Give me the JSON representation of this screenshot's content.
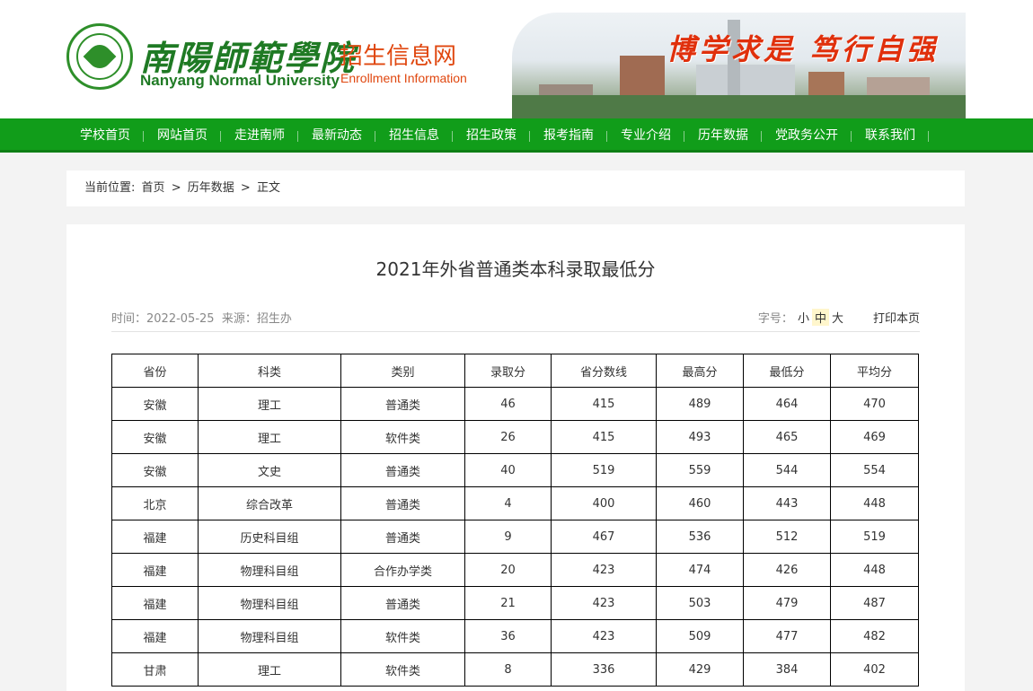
{
  "header": {
    "logo_text_cn": "南陽師範學院",
    "logo_text_en": "Nanyang Normal University",
    "site_title_cn": "招生信息网",
    "site_title_en": "Enrollment Information",
    "motto": "博学求是 笃行自强"
  },
  "nav": {
    "items": [
      {
        "label": "学校首页"
      },
      {
        "label": "网站首页"
      },
      {
        "label": "走进南师"
      },
      {
        "label": "最新动态"
      },
      {
        "label": "招生信息"
      },
      {
        "label": "招生政策"
      },
      {
        "label": "报考指南"
      },
      {
        "label": "专业介绍"
      },
      {
        "label": "历年数据"
      },
      {
        "label": "党政务公开"
      },
      {
        "label": "联系我们"
      }
    ]
  },
  "breadcrumb": {
    "prefix": "当前位置:",
    "home": "首页",
    "sep": ">",
    "section": "历年数据",
    "current": "正文"
  },
  "article": {
    "title": "2021年外省普通类本科录取最低分",
    "time_label": "时间：",
    "time": "2022-05-25",
    "source_label": "来源：",
    "source": "招生办",
    "font_size_label": "字号：",
    "font_small": "小",
    "font_medium": "中",
    "font_large": "大",
    "print_label": "打印本页"
  },
  "table": {
    "headers": [
      "省份",
      "科类",
      "类别",
      "录取分",
      "省分数线",
      "最高分",
      "最低分",
      "平均分"
    ],
    "rows": [
      [
        "安徽",
        "理工",
        "普通类",
        "46",
        "415",
        "489",
        "464",
        "470"
      ],
      [
        "安徽",
        "理工",
        "软件类",
        "26",
        "415",
        "493",
        "465",
        "469"
      ],
      [
        "安徽",
        "文史",
        "普通类",
        "40",
        "519",
        "559",
        "544",
        "554"
      ],
      [
        "北京",
        "综合改革",
        "普通类",
        "4",
        "400",
        "460",
        "443",
        "448"
      ],
      [
        "福建",
        "历史科目组",
        "普通类",
        "9",
        "467",
        "536",
        "512",
        "519"
      ],
      [
        "福建",
        "物理科目组",
        "合作办学类",
        "20",
        "423",
        "474",
        "426",
        "448"
      ],
      [
        "福建",
        "物理科目组",
        "普通类",
        "21",
        "423",
        "503",
        "479",
        "487"
      ],
      [
        "福建",
        "物理科目组",
        "软件类",
        "36",
        "423",
        "509",
        "477",
        "482"
      ],
      [
        "甘肃",
        "理工",
        "软件类",
        "8",
        "336",
        "429",
        "384",
        "402"
      ]
    ]
  }
}
